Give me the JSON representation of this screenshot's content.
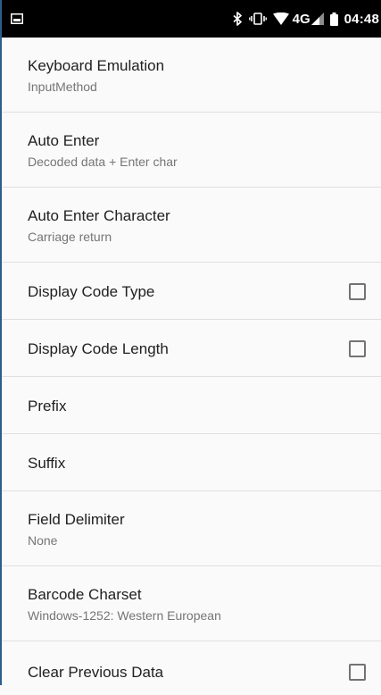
{
  "status_bar": {
    "time": "04:48",
    "network": "4G",
    "icons": [
      "screenshot-icon",
      "bluetooth-icon",
      "vibrate-icon",
      "wifi-icon",
      "cell-signal-icon",
      "battery-icon"
    ]
  },
  "settings": [
    {
      "title": "Keyboard Emulation",
      "summary": "InputMethod"
    },
    {
      "title": "Auto Enter",
      "summary": "Decoded data + Enter char"
    },
    {
      "title": "Auto Enter Character",
      "summary": "Carriage return"
    },
    {
      "title": "Display Code Type",
      "checked": false
    },
    {
      "title": "Display Code Length",
      "checked": false
    },
    {
      "title": "Prefix"
    },
    {
      "title": "Suffix"
    },
    {
      "title": "Field Delimiter",
      "summary": "None"
    },
    {
      "title": "Barcode Charset",
      "summary": "Windows-1252: Western European"
    },
    {
      "title": "Clear Previous Data",
      "checked": false
    }
  ]
}
